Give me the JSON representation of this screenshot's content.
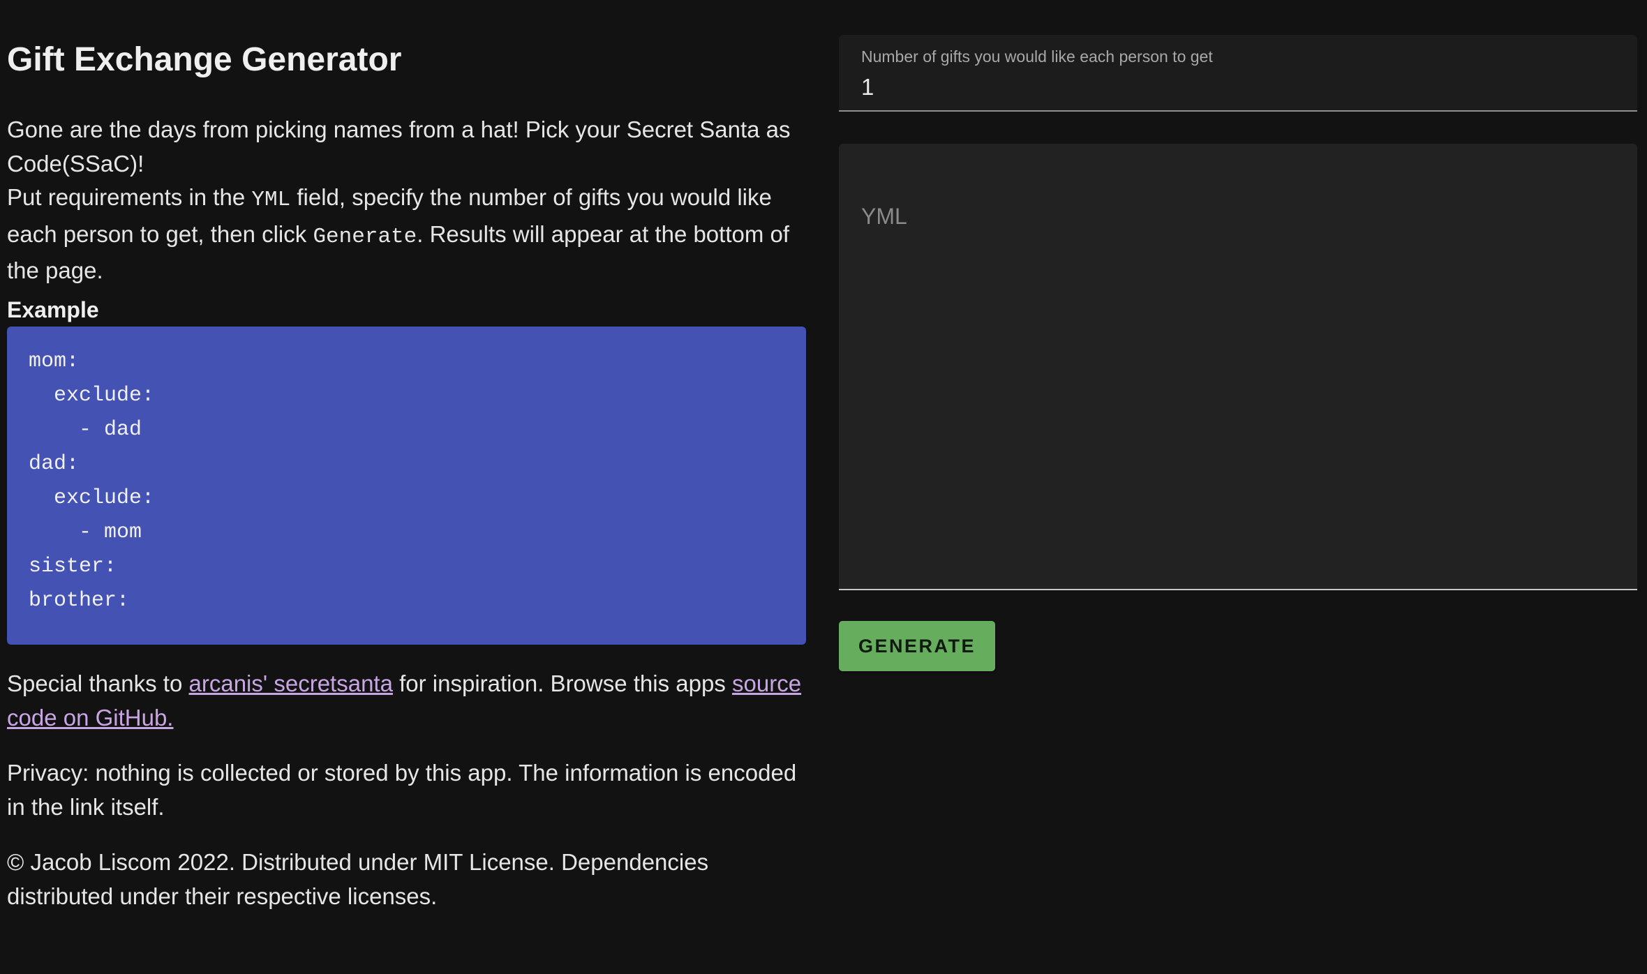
{
  "header": {
    "title": "Gift Exchange Generator"
  },
  "intro": {
    "line1": "Gone are the days from picking names from a hat! Pick your Secret Santa as Code(SSaC)!",
    "line2_pre": "Put requirements in the ",
    "line2_code": "YML",
    "line2_mid": " field, specify the number of gifts you would like each person to get, then click ",
    "line2_code2": "Generate",
    "line2_post": ". Results will appear at the bottom of the page."
  },
  "example": {
    "label": "Example",
    "lines": [
      "mom:",
      "  exclude:",
      "    - dad",
      "dad:",
      "  exclude:",
      "    - mom",
      "sister:",
      "brother:"
    ]
  },
  "thanks": {
    "pre": "Special thanks to ",
    "link1": "arcanis' secretsanta",
    "mid": " for inspiration. Browse this apps ",
    "link2": "source code on GitHub."
  },
  "privacy": {
    "text": "Privacy: nothing is collected or stored by this app. The information is encoded in the link itself."
  },
  "copyright": {
    "text": "© Jacob Liscom 2022. Distributed under MIT License. Dependencies distributed under their respective licenses."
  },
  "form": {
    "gifts_label": "Number of gifts you would like each person to get",
    "gifts_value": "1",
    "yml_placeholder": "YML",
    "generate_label": "GENERATE"
  },
  "colors": {
    "background": "#121212",
    "code_box": "#4452b4",
    "link": "#c8a6e4",
    "button": "#66ad5e"
  }
}
